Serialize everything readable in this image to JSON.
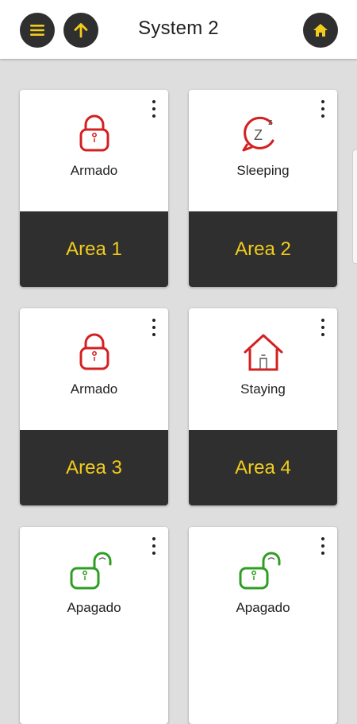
{
  "header": {
    "title": "System 2",
    "menu_icon": "hamburger-icon",
    "up_icon": "arrow-up-icon",
    "home_icon": "home-icon"
  },
  "colors": {
    "accent_yellow": "#f2cc1c",
    "dark": "#2f2f2f",
    "armed_red": "#d42020",
    "disarmed_green": "#2e9e22"
  },
  "areas": [
    {
      "name": "Area 1",
      "status": "Armado",
      "icon": "locked-padlock-icon"
    },
    {
      "name": "Area 2",
      "status": "Sleeping",
      "icon": "sleep-bubble-icon"
    },
    {
      "name": "Area 3",
      "status": "Armado",
      "icon": "locked-padlock-icon"
    },
    {
      "name": "Area 4",
      "status": "Staying",
      "icon": "house-icon"
    },
    {
      "name": "",
      "status": "Apagado",
      "icon": "unlocked-padlock-icon"
    },
    {
      "name": "",
      "status": "Apagado",
      "icon": "unlocked-padlock-icon"
    }
  ]
}
